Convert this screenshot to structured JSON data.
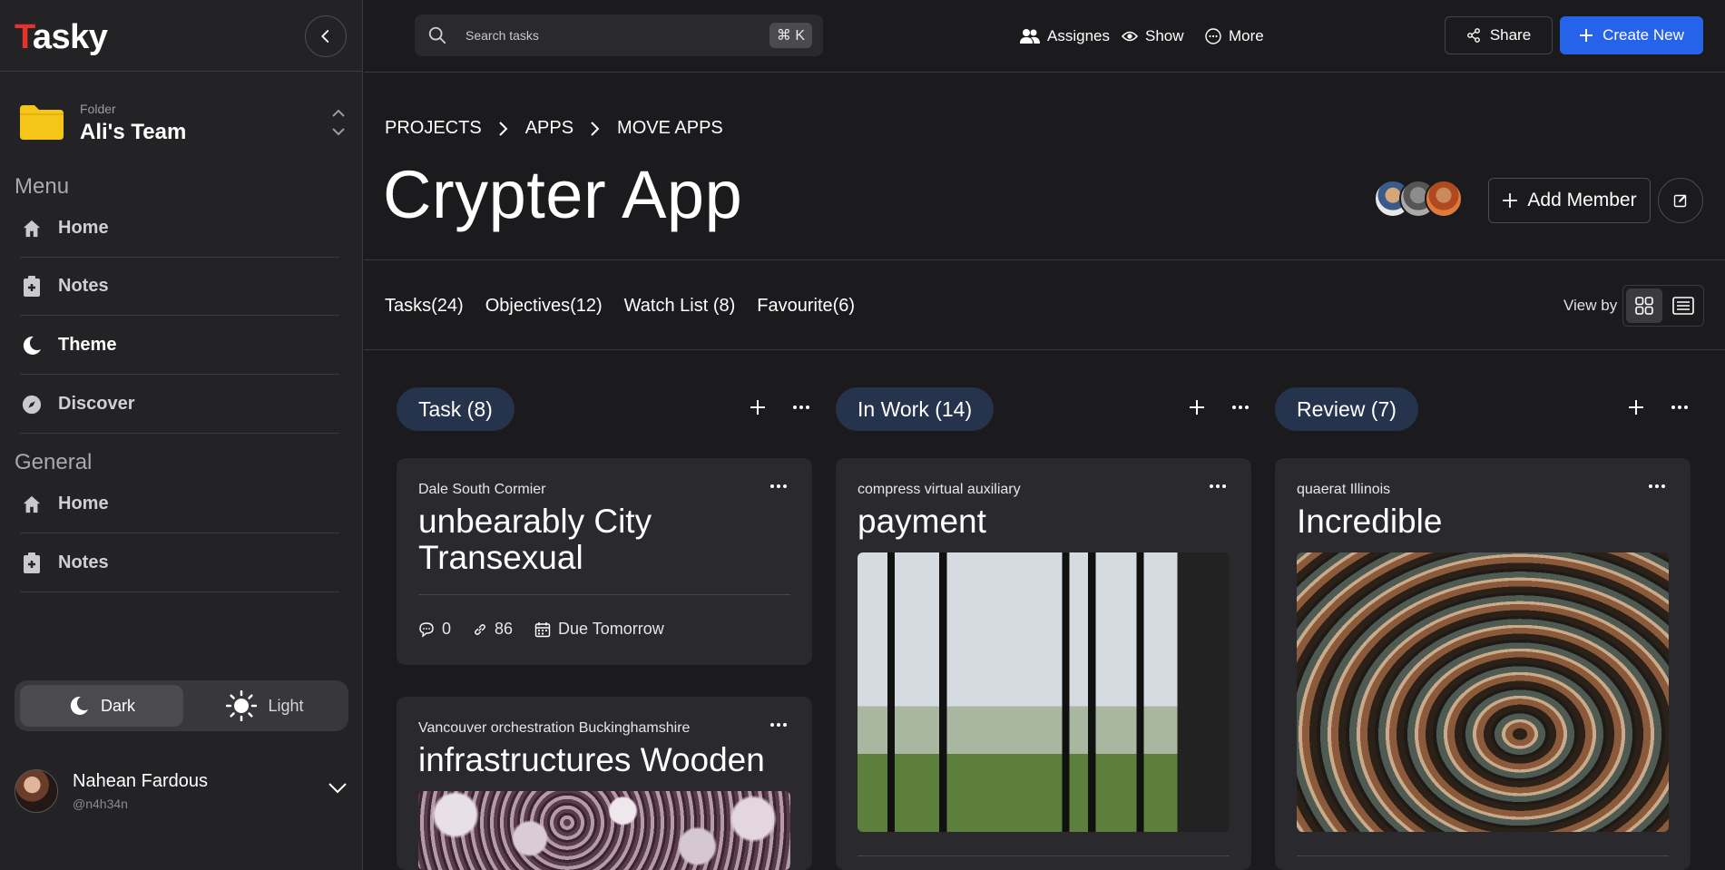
{
  "app": {
    "logo_first": "T",
    "logo_rest": "asky"
  },
  "sidebar": {
    "folder_label": "Folder",
    "folder_name": "Ali's Team",
    "menu_title": "Menu",
    "menu_items": [
      {
        "label": "Home",
        "icon": "home-icon"
      },
      {
        "label": "Notes",
        "icon": "notes-icon"
      },
      {
        "label": "Theme",
        "icon": "moon-icon"
      },
      {
        "label": "Discover",
        "icon": "compass-icon"
      }
    ],
    "general_title": "General",
    "general_items": [
      {
        "label": "Home",
        "icon": "home-icon"
      },
      {
        "label": "Notes",
        "icon": "notes-icon"
      }
    ],
    "theme_dark": "Dark",
    "theme_light": "Light",
    "user_name": "Nahean Fardous",
    "user_handle": "@n4h34n"
  },
  "topbar": {
    "search_placeholder": "Search tasks",
    "shortcut": "⌘ K",
    "assignees": "Assignes",
    "show": "Show",
    "more": "More",
    "share": "Share",
    "create": "Create New"
  },
  "header": {
    "breadcrumb": [
      "PROJECTS",
      "APPS",
      "MOVE APPS"
    ],
    "title": "Crypter App",
    "add_member": "Add Member"
  },
  "tabs": [
    "Tasks(24)",
    "Objectives(12)",
    "Watch List (8)",
    "Favourite(6)"
  ],
  "view_by_label": "View by",
  "columns": [
    {
      "title": "Task (8)",
      "cards": [
        {
          "subtitle": "Dale South Cormier",
          "title": "unbearably City Transexual",
          "comments": "0",
          "links": "86",
          "due": "Due Tomorrow"
        },
        {
          "subtitle": "Vancouver orchestration Buckinghamshire",
          "title": "infrastructures Wooden"
        }
      ]
    },
    {
      "title": "In Work (14)",
      "cards": [
        {
          "subtitle": "compress virtual auxiliary",
          "title": "payment"
        }
      ]
    },
    {
      "title": "Review (7)",
      "cards": [
        {
          "subtitle": "quaerat Illinois",
          "title": "Incredible"
        }
      ]
    }
  ],
  "colors": {
    "accent": "#2563eb",
    "logo_red": "#e5322d",
    "pill_bg": "#26334d",
    "folder": "#f5c518"
  }
}
